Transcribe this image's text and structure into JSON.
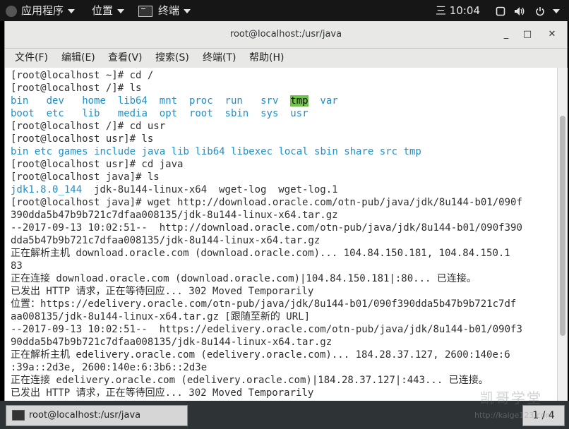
{
  "topbar": {
    "applications": "应用程序",
    "places": "位置",
    "terminal_app": "终端",
    "clock": "三 10:04"
  },
  "window": {
    "title": "root@localhost:/usr/java",
    "minimize": "_",
    "maximize": "□",
    "close": "✕"
  },
  "menubar": {
    "file": "文件(F)",
    "edit": "编辑(E)",
    "view": "查看(V)",
    "search": "搜索(S)",
    "terminal": "终端(T)",
    "help": "帮助(H)"
  },
  "terminal": {
    "l1": "[root@localhost ~]# cd /",
    "l2": "[root@localhost /]# ls",
    "ls_root_row1": [
      "bin",
      "dev",
      "home",
      "lib64",
      "mnt",
      "proc",
      "run",
      "srv",
      "tmp",
      "var"
    ],
    "ls_root_row2": [
      "boot",
      "etc",
      "lib",
      "media",
      "opt",
      "root",
      "sbin",
      "sys",
      "usr"
    ],
    "l5": "[root@localhost /]# cd usr",
    "l6": "[root@localhost usr]# ls",
    "ls_usr": [
      "bin",
      "etc",
      "games",
      "include",
      "java",
      "lib",
      "lib64",
      "libexec",
      "local",
      "sbin",
      "share",
      "src",
      "tmp"
    ],
    "l8": "[root@localhost usr]# cd java",
    "l9": "[root@localhost java]# ls",
    "ls_java_dir": "jdk1.8.0_144",
    "ls_java_files": "  jdk-8u144-linux-x64  wget-log  wget-log.1",
    "l11": "[root@localhost java]# wget http://download.oracle.com/otn-pub/java/jdk/8u144-b01/090f",
    "l12": "390dda5b47b9b721c7dfaa008135/jdk-8u144-linux-x64.tar.gz",
    "l13": "--2017-09-13 10:02:51--  http://download.oracle.com/otn-pub/java/jdk/8u144-b01/090f390",
    "l14": "dda5b47b9b721c7dfaa008135/jdk-8u144-linux-x64.tar.gz",
    "l15": "正在解析主机 download.oracle.com (download.oracle.com)... 104.84.150.181, 104.84.150.1",
    "l16": "83",
    "l17": "正在连接 download.oracle.com (download.oracle.com)|104.84.150.181|:80... 已连接。",
    "l18": "已发出 HTTP 请求，正在等待回应... 302 Moved Temporarily",
    "l19": "位置：https://edelivery.oracle.com/otn-pub/java/jdk/8u144-b01/090f390dda5b47b9b721c7df",
    "l20": "aa008135/jdk-8u144-linux-x64.tar.gz [跟随至新的 URL]",
    "l21": "--2017-09-13 10:02:51--  https://edelivery.oracle.com/otn-pub/java/jdk/8u144-b01/090f3",
    "l22": "90dda5b47b9b721c7dfaa008135/jdk-8u144-linux-x64.tar.gz",
    "l23": "正在解析主机 edelivery.oracle.com (edelivery.oracle.com)... 184.28.37.127, 2600:140e:6",
    "l24": ":39a::2d3e, 2600:140e:6:3b6::2d3e",
    "l25": "正在连接 edelivery.oracle.com (edelivery.oracle.com)|184.28.37.127|:443... 已连接。",
    "l26": "已发出 HTTP 请求，正在等待回应... 302 Moved Temporarily"
  },
  "taskbar": {
    "task_label": "root@localhost:/usr/java",
    "pager": "1 / 4"
  },
  "watermark": {
    "text": "凯哥学堂",
    "url": "http://kaige123.com"
  },
  "colors": {
    "directory": "#1f8fc7",
    "tmp_highlight": "#6fc24a",
    "topbar": "#161616"
  }
}
